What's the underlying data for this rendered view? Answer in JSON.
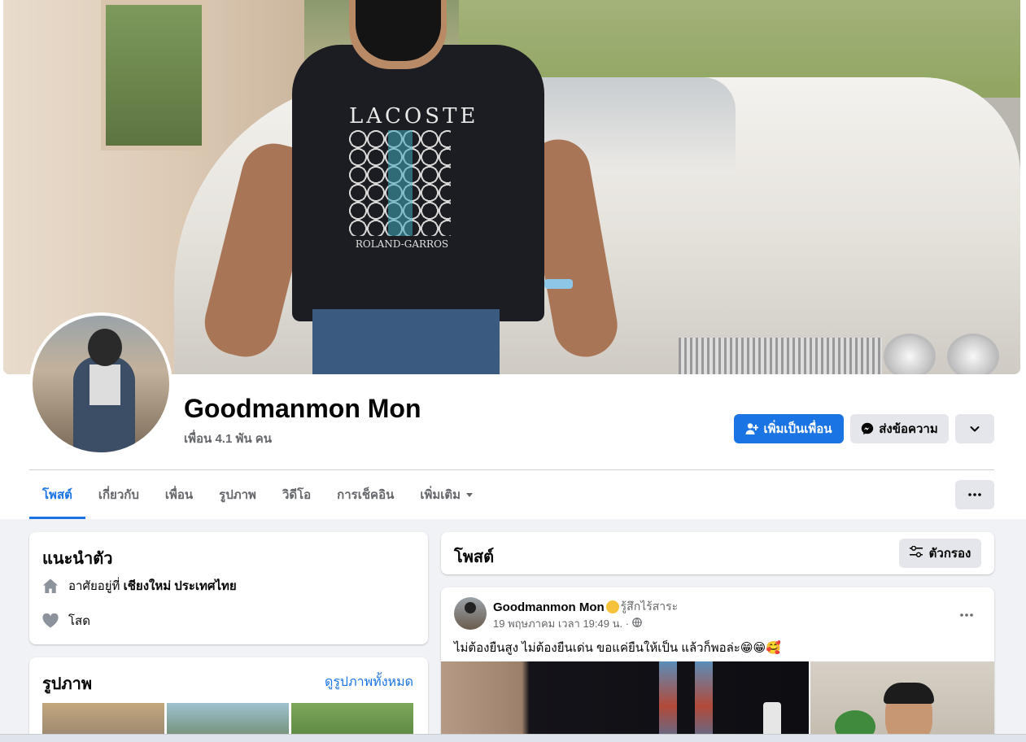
{
  "profile": {
    "name": "Goodmanmon Mon",
    "friends_count": "เพื่อน 4.1 พัน คน"
  },
  "cover": {
    "shirt_brand": "LACOSTE",
    "shirt_sub": "ROLAND-GARROS"
  },
  "actions": {
    "add_friend": "เพิ่มเป็นเพื่อน",
    "message": "ส่งข้อความ"
  },
  "tabs": [
    {
      "label": "โพสต์",
      "active": true
    },
    {
      "label": "เกี่ยวกับ"
    },
    {
      "label": "เพื่อน"
    },
    {
      "label": "รูปภาพ"
    },
    {
      "label": "วิดีโอ"
    },
    {
      "label": "การเช็คอิน"
    },
    {
      "label": "เพิ่มเติม"
    }
  ],
  "intro": {
    "title": "แนะนำตัว",
    "lives_prefix": "อาศัยอยู่ที่",
    "lives_place": "เชียงใหม่ ประเทศไทย",
    "relationship": "โสด"
  },
  "photos": {
    "title": "รูปภาพ",
    "see_all": "ดูรูปภาพทั้งหมด"
  },
  "posts": {
    "title": "โพสต์",
    "filter_label": "ตัวกรอง"
  },
  "post": {
    "author": "Goodmanmon Mon",
    "feeling": "รู้สึกไร้สาระ",
    "timestamp": "19 พฤษภาคม เวลา 19:49 น. ·",
    "text": "ไม่ต้องยืนสูง ไม่ต้องยืนเด่น ขอแค่ยืนให้เป็น แล้วก็พอล่ะ😁😁🥰"
  },
  "colors": {
    "accent": "#1b74e4",
    "secondary_button": "#e4e6eb",
    "page_bg": "#f0f2f5"
  },
  "icons": {
    "add_friend": "person-plus-icon",
    "message": "messenger-icon",
    "dropdown": "chevron-down-icon",
    "more": "ellipsis-icon",
    "home": "home-icon",
    "heart": "heart-icon",
    "filter": "sliders-icon",
    "globe": "globe-icon"
  }
}
